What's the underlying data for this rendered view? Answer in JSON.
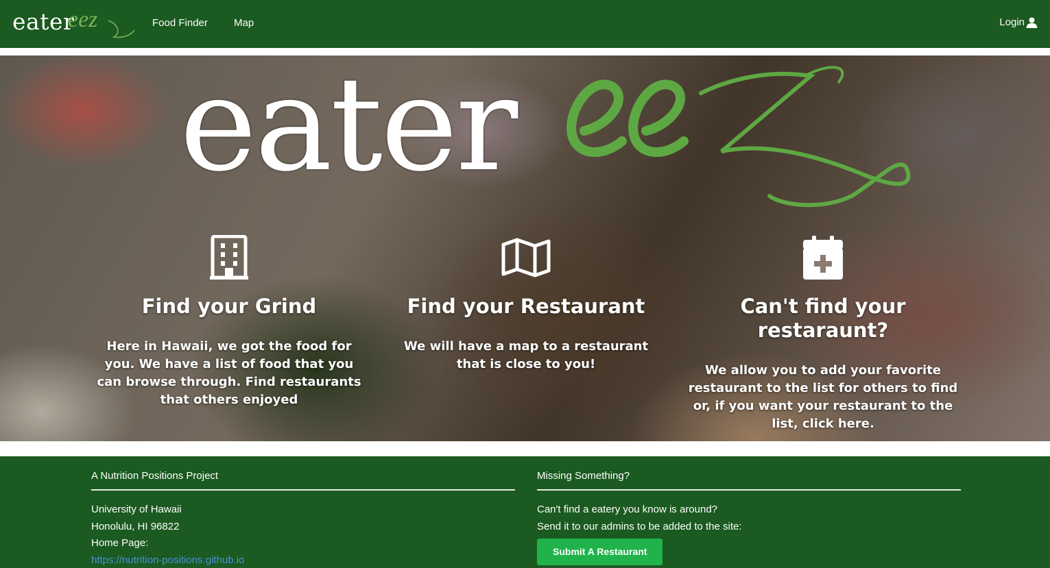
{
  "navbar": {
    "brand_eater": "eater",
    "brand_eez": "eez",
    "links": [
      {
        "label": "Food Finder"
      },
      {
        "label": "Map"
      }
    ],
    "login_label": "Login",
    "background_color": "#1b5a20"
  },
  "hero": {
    "logo_eater": "eater",
    "logo_eez": "eez",
    "accent_color": "#5ea843",
    "features": [
      {
        "icon": "building-icon",
        "title": "Find your Grind",
        "text": "Here in Hawaii, we got the food for you. We have a list of food that you can browse through. Find restaurants that others enjoyed"
      },
      {
        "icon": "map-icon",
        "title": "Find your Restaurant",
        "text": "We will have a map to a restaurant that is close to you!"
      },
      {
        "icon": "calendar-plus-icon",
        "title": "Can't find your restaraunt?",
        "text": "We allow you to add your favorite restaurant to the list for others to find or, if you want your restaurant to the list, click here."
      }
    ]
  },
  "footer": {
    "left": {
      "heading": "A Nutrition Positions Project",
      "lines": [
        "University of Hawaii",
        "Honolulu, HI 96822",
        "Home Page:"
      ],
      "link": "https://nutrition-positions.github.io"
    },
    "right": {
      "heading": "Missing Something?",
      "lines": [
        "Can't find a eatery you know is around?",
        "Send it to our admins to be added to the site:"
      ],
      "button_label": "Submit A Restaurant",
      "button_color": "#21b34b"
    }
  }
}
